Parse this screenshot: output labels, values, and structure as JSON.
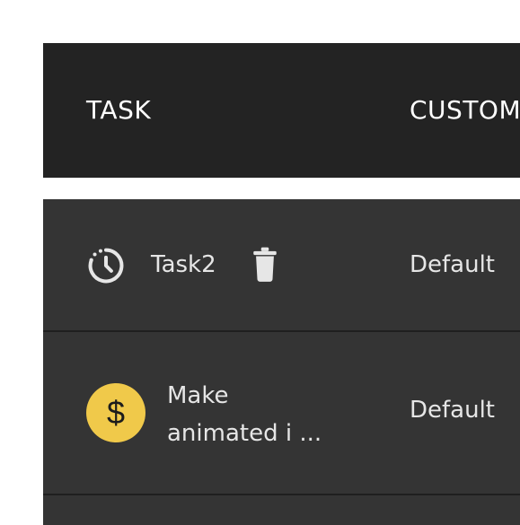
{
  "table": {
    "columns": {
      "task": "TASK",
      "customer": "CUSTOM"
    },
    "rows": [
      {
        "icon": "clock-icon",
        "title": "Task2",
        "action_icon": "trash-icon",
        "customer": "Default"
      },
      {
        "icon": "dollar-icon",
        "title_line1": "Make",
        "title_line2": "animated i ...",
        "badge_symbol": "$",
        "customer": "Default"
      }
    ]
  },
  "colors": {
    "header_bg": "#232323",
    "body_bg": "#343434",
    "text_primary": "#ffffff",
    "text_secondary": "#e6e6e6",
    "badge_yellow": "#f0c94a"
  }
}
